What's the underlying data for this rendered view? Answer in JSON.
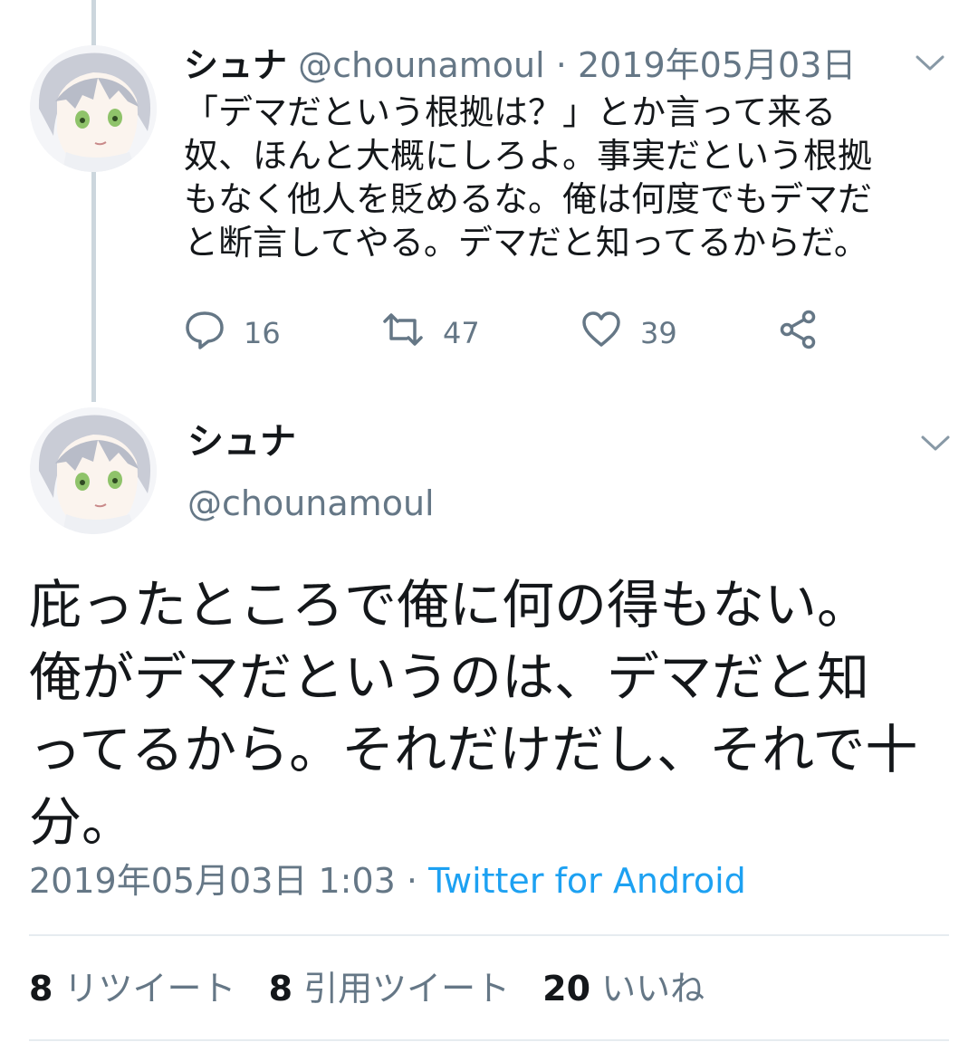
{
  "parent_tweet": {
    "display_name": "シュナ",
    "handle": "@chounamoul",
    "separator": " · ",
    "date": "2019年05月03日",
    "text": "「デマだという根拠は？」とか言って来る\n奴、ほんと大概にしろよ。事実だという根拠\nもなく他人を貶めるな。俺は何度でもデマだ\nと断言してやる。デマだと知ってるからだ。",
    "replies": "16",
    "retweets": "47",
    "likes": "39"
  },
  "focused_tweet": {
    "display_name": "シュナ",
    "handle": "@chounamoul",
    "text": "庇ったところで俺に何の得もない。\n俺がデマだというのは、デマだと知\nってるから。それだけだし、それで十\n分。",
    "timestamp": "2019年05月03日 1:03",
    "separator": " · ",
    "source": "Twitter for Android",
    "retweet_count": "8",
    "retweet_label": "リツイート",
    "quote_count": "8",
    "quote_label": "引用ツイート",
    "like_count": "20",
    "like_label": "いいね"
  },
  "icons": {
    "reply": "reply-icon",
    "retweet": "retweet-icon",
    "like": "heart-icon",
    "share": "share-icon",
    "menu": "chevron-down-icon"
  },
  "colors": {
    "text": "#14171a",
    "secondary": "#657786",
    "link": "#1da1f2",
    "divider": "#e6ecf0"
  }
}
